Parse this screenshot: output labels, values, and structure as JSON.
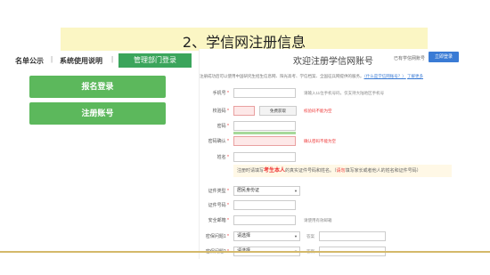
{
  "slide_title": "2、学信网注册信息",
  "nav": {
    "item1": "名单公示",
    "sep": "|",
    "item2": "系统使用说明",
    "mgmt": "管理部门登录"
  },
  "buttons": {
    "report_login": "报名登录",
    "register": "注册账号"
  },
  "form": {
    "title": "欢迎注册学信网账号",
    "has_account": "已有学信网账号",
    "login_now": "立即登录",
    "intro_text": "注册成功后可以使用中国研究生招生信息网、阳光高考、学信档案、全国征兵网提供的服务。",
    "intro_link": "（什么是学信网账号？）",
    "help_link": "了解更多",
    "phone_label": "手机号",
    "phone_hint": "请输入11位手机号码，仅支持大陆地区手机号",
    "captcha_label": "校验码",
    "captcha_button": "免费获取",
    "captcha_error": "校验码不能为空",
    "password_label": "密码",
    "confirm_label": "密码确认",
    "confirm_error": "确认密码不能为空",
    "name_label": "姓名",
    "notice_pre": "注册时请填写",
    "notice_bold": "考生本人",
    "notice_mid": "的真实证件号码和姓名。（",
    "notice_red": "请勿",
    "notice_post": "填写家长或者他人的姓名和证件号码）",
    "idtype_label": "证件类型",
    "idtype_value": "居民身份证",
    "idnum_label": "证件号码",
    "email_label": "安全邮箱",
    "email_hint": "请使用有效邮箱",
    "q1_label": "密保问题1",
    "q1_value": "请选择",
    "q2_label": "密保问题2",
    "q2_value": "请选择",
    "answer_label": "答案"
  },
  "colors": {
    "green": "#5cb85c",
    "title_bg": "#fbf6c4",
    "blue": "#3a7bd5",
    "error": "#e33333"
  }
}
